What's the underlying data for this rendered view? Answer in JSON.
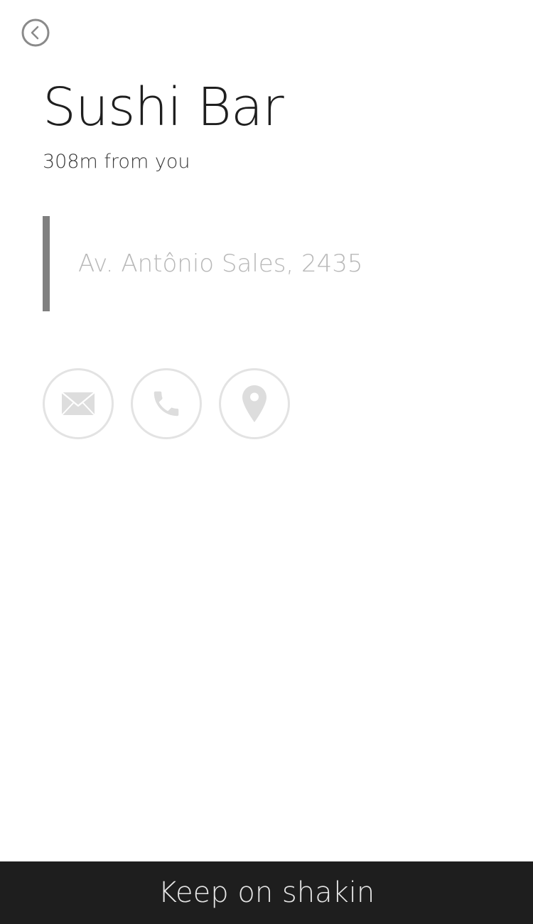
{
  "header": {
    "back_icon": "chevron-left-circle-icon"
  },
  "place": {
    "name": "Sushi Bar",
    "distance": "308m from you",
    "address": "Av. Antônio Sales, 2435"
  },
  "actions": [
    {
      "id": "email",
      "icon": "envelope-icon"
    },
    {
      "id": "phone",
      "icon": "phone-icon"
    },
    {
      "id": "map",
      "icon": "map-pin-icon"
    }
  ],
  "footer": {
    "label": "Keep on shakin"
  },
  "colors": {
    "background": "#ffffff",
    "title_text": "#1f1f1f",
    "address_bar": "#808080",
    "address_text": "#b8b8b8",
    "action_icon": "#dddddd",
    "footer_background": "#1e1e1e",
    "footer_text": "#e6e6e6"
  }
}
